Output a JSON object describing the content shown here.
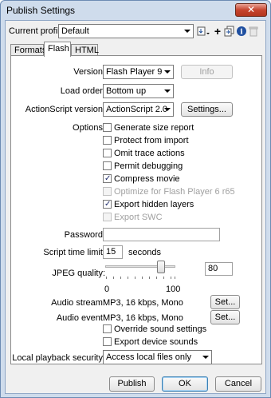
{
  "window": {
    "title": "Publish Settings",
    "close_glyph": "✕"
  },
  "profile": {
    "label": "Current profile:",
    "value": "Default",
    "toolbar_icons": [
      "import-export-icon",
      "add-profile-icon",
      "duplicate-profile-icon",
      "profile-info-icon",
      "delete-profile-icon"
    ]
  },
  "tabs": [
    {
      "label": "Formats"
    },
    {
      "label": "Flash"
    },
    {
      "label": "HTML"
    }
  ],
  "flash": {
    "version_label": "Version:",
    "version_value": "Flash Player 9",
    "info_button": "Info",
    "load_order_label": "Load order:",
    "load_order_value": "Bottom up",
    "as_label": "ActionScript version:",
    "as_value": "ActionScript 2.0",
    "settings_button": "Settings...",
    "options_label": "Options:",
    "options": [
      {
        "label": "Generate size report",
        "checked": false,
        "disabled": false
      },
      {
        "label": "Protect from import",
        "checked": false,
        "disabled": false
      },
      {
        "label": "Omit trace actions",
        "checked": false,
        "disabled": false
      },
      {
        "label": "Permit debugging",
        "checked": false,
        "disabled": false
      },
      {
        "label": "Compress movie",
        "checked": true,
        "disabled": false
      },
      {
        "label": "Optimize for Flash Player 6 r65",
        "checked": false,
        "disabled": true
      },
      {
        "label": "Export hidden layers",
        "checked": true,
        "disabled": false
      },
      {
        "label": "Export SWC",
        "checked": false,
        "disabled": true
      }
    ],
    "password_label": "Password:",
    "password_value": "",
    "script_time_label": "Script time limit:",
    "script_time_value": "15",
    "script_time_unit": "seconds",
    "jpeg_label": "JPEG quality:",
    "jpeg_value": "80",
    "jpeg_min": "0",
    "jpeg_max": "100",
    "audio_stream_label": "Audio stream:",
    "audio_stream_value": "MP3, 16 kbps, Mono",
    "audio_stream_button": "Set...",
    "audio_event_label": "Audio event:",
    "audio_event_value": "MP3, 16 kbps, Mono",
    "audio_event_button": "Set...",
    "audio_options": [
      {
        "label": "Override sound settings",
        "checked": false
      },
      {
        "label": "Export device sounds",
        "checked": false
      }
    ],
    "security_label": "Local playback security:",
    "security_value": "Access local files only"
  },
  "footer": {
    "publish": "Publish",
    "ok": "OK",
    "cancel": "Cancel"
  }
}
